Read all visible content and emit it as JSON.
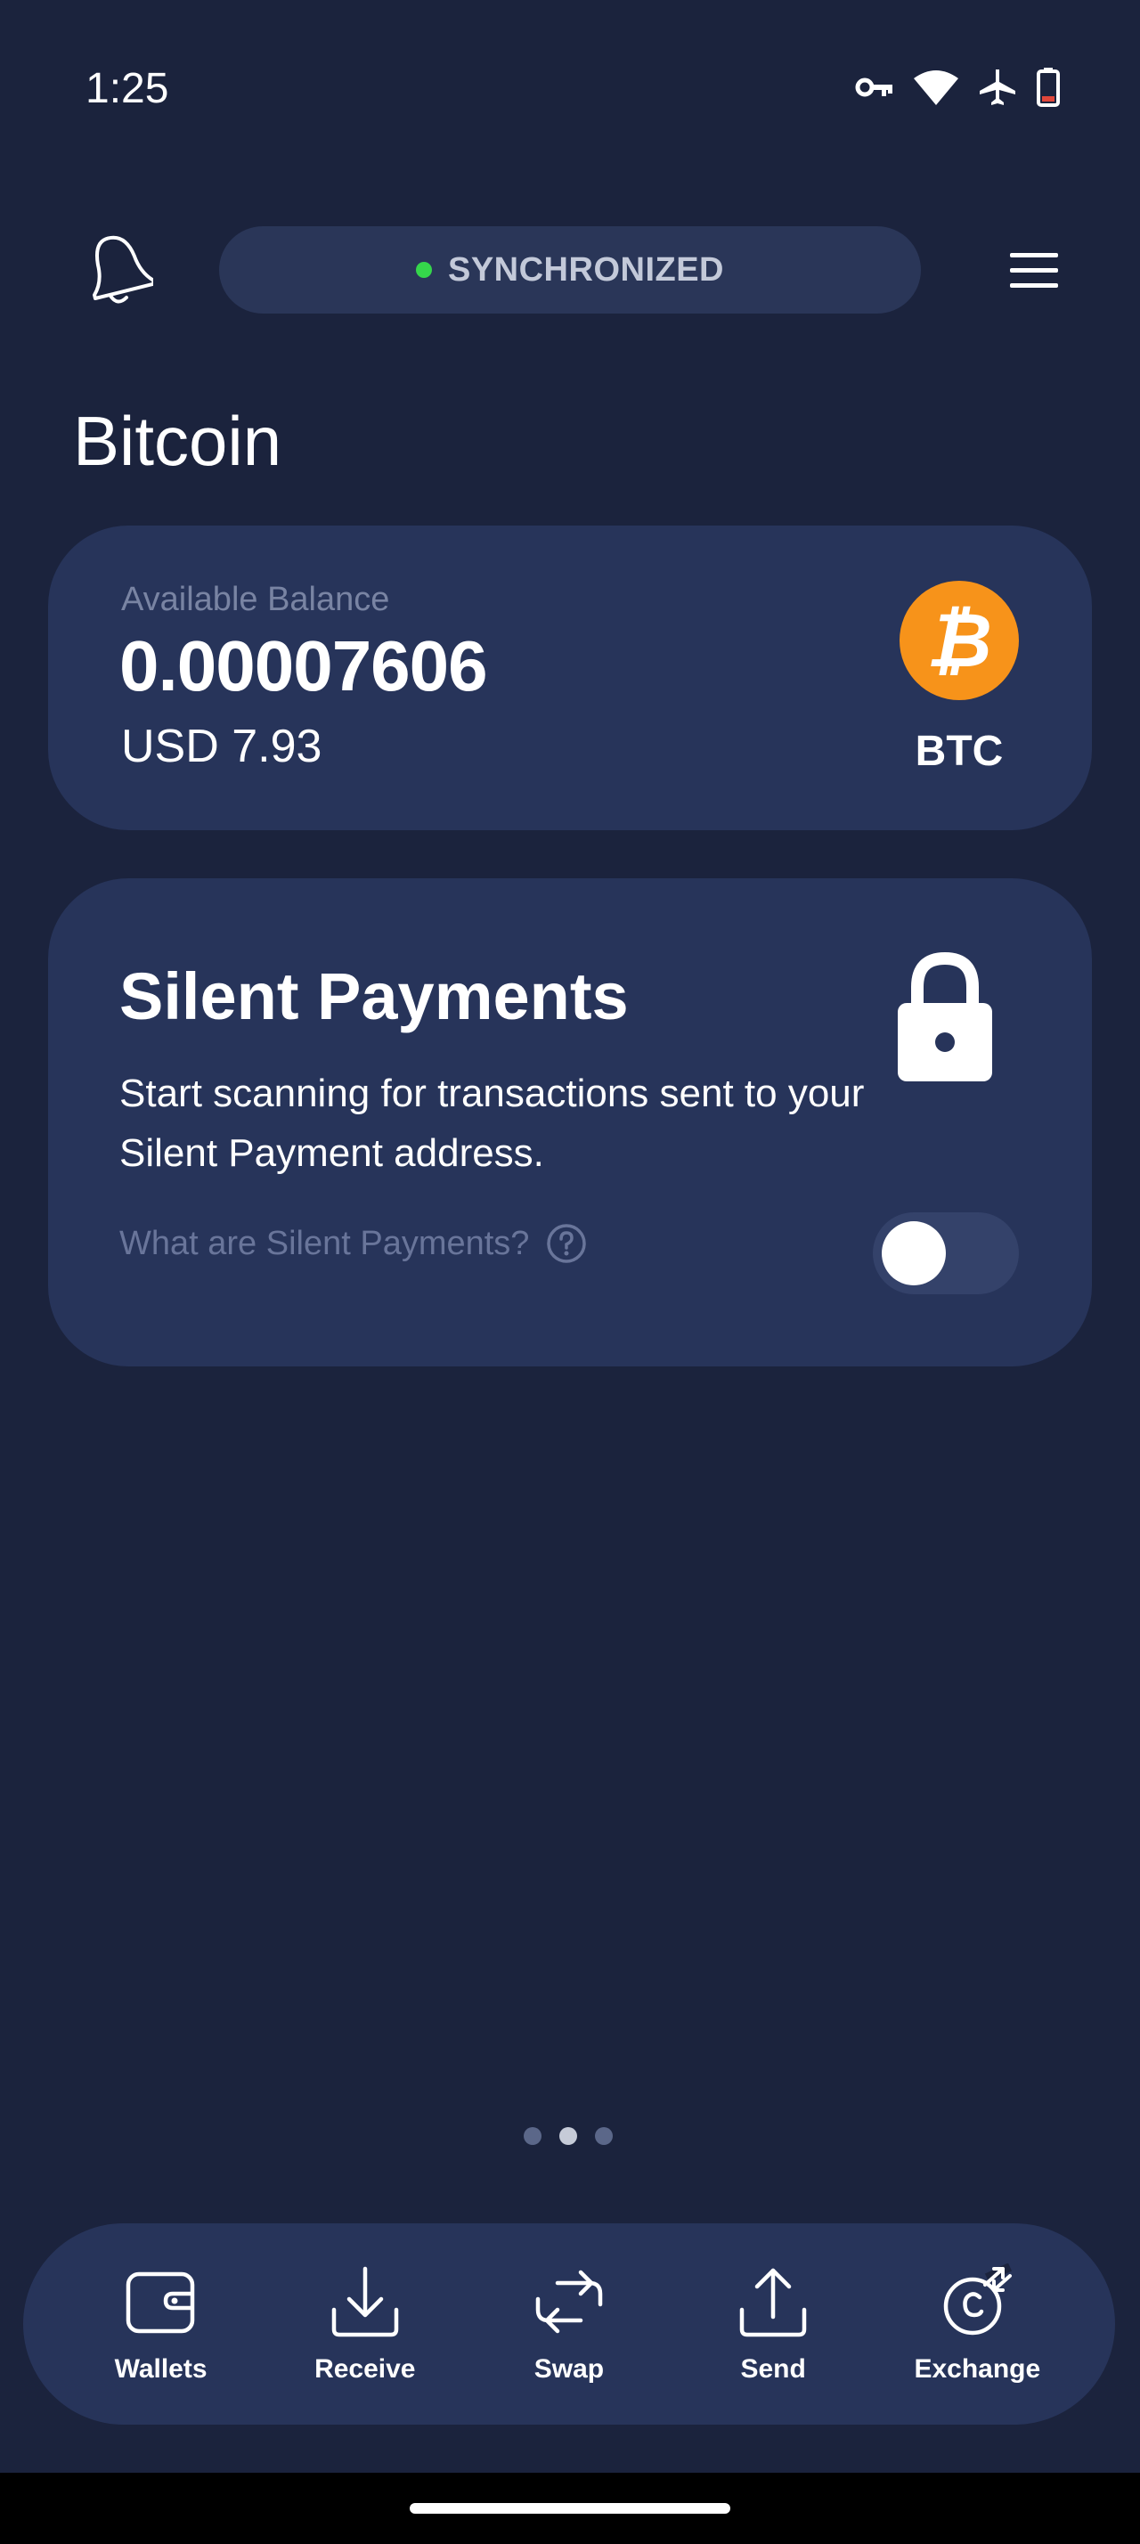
{
  "status_bar": {
    "time": "1:25",
    "icons": [
      "vpn-key-icon",
      "wifi-icon",
      "airplane-icon",
      "battery-low-icon"
    ],
    "battery_color": "#e0463a"
  },
  "header": {
    "sync_status": "SYNCHRONIZED",
    "sync_dot_color": "#35d64b"
  },
  "page": {
    "title": "Bitcoin"
  },
  "balance_card": {
    "label": "Available Balance",
    "amount": "0.00007606",
    "fiat": "USD 7.93",
    "currency_symbol": "BTC",
    "logo_color": "#f7931a"
  },
  "silent_payments": {
    "title": "Silent Payments",
    "description": "Start scanning for transactions sent to your Silent Payment address.",
    "link_text": "What are Silent Payments?",
    "toggle_on": false
  },
  "pager": {
    "count": 3,
    "active_index": 1
  },
  "bottom_nav": {
    "items": [
      {
        "label": "Wallets",
        "icon": "wallet-icon"
      },
      {
        "label": "Receive",
        "icon": "download-icon"
      },
      {
        "label": "Swap",
        "icon": "swap-icon"
      },
      {
        "label": "Send",
        "icon": "upload-icon"
      },
      {
        "label": "Exchange",
        "icon": "exchange-icon"
      }
    ]
  },
  "colors": {
    "background": "#1b233d",
    "card": "#27345a",
    "muted_text": "#7984a3"
  }
}
